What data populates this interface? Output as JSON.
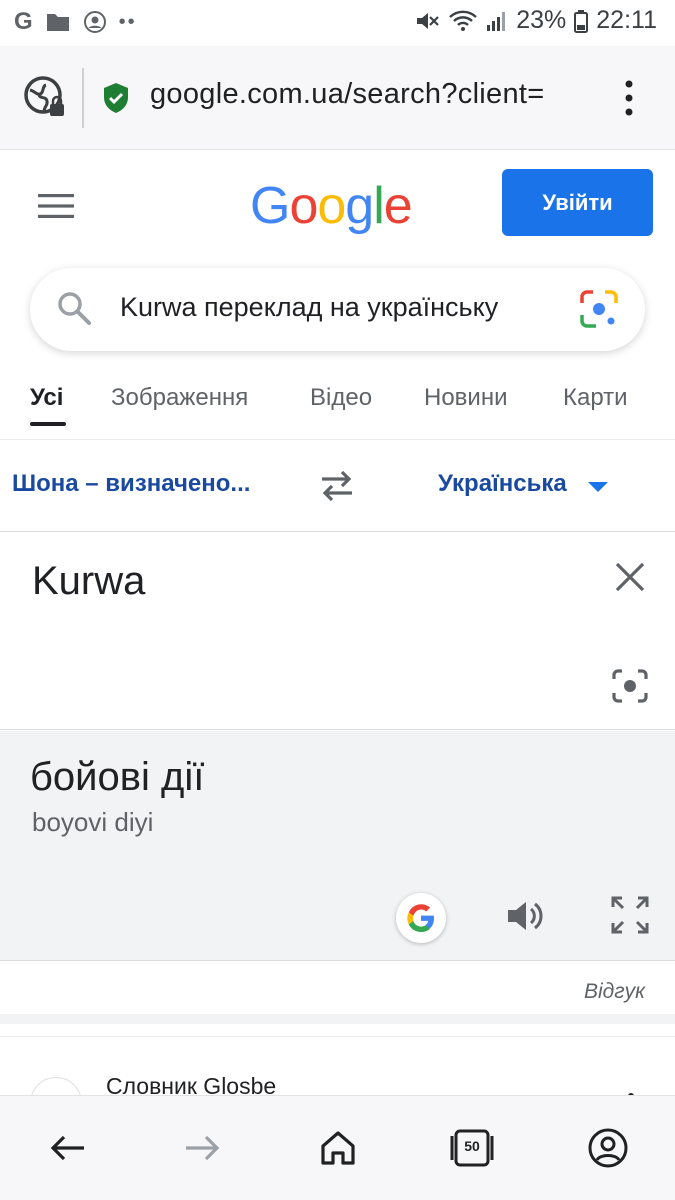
{
  "status_bar": {
    "battery": "23%",
    "time": "22:11",
    "g_label": "G",
    "dots": "••"
  },
  "browser": {
    "url": "google.com.ua/search?client="
  },
  "google": {
    "logo": [
      "G",
      "o",
      "o",
      "g",
      "l",
      "e"
    ],
    "logo_colors": [
      "#4285f4",
      "#ea4335",
      "#fbbc05",
      "#4285f4",
      "#34a853",
      "#ea4335"
    ],
    "login_label": "Увійти"
  },
  "search": {
    "query": "Kurwa переклад на українську"
  },
  "tabs": [
    {
      "label": "Усі"
    },
    {
      "label": "Зображення"
    },
    {
      "label": "Відео"
    },
    {
      "label": "Новини"
    },
    {
      "label": "Карти"
    }
  ],
  "translate": {
    "source_lang": "Шона – визначено...",
    "target_lang": "Українська",
    "source_text": "Kurwa",
    "target_text": "бойові дії",
    "transliteration": "boyovi diyi",
    "feedback": "Відгук"
  },
  "result": {
    "title": "Словник Glosbe"
  },
  "bottom_nav": {
    "tabs_count": "50"
  },
  "colors": {
    "accent": "#1a73e8",
    "link": "#1a4aa0"
  }
}
